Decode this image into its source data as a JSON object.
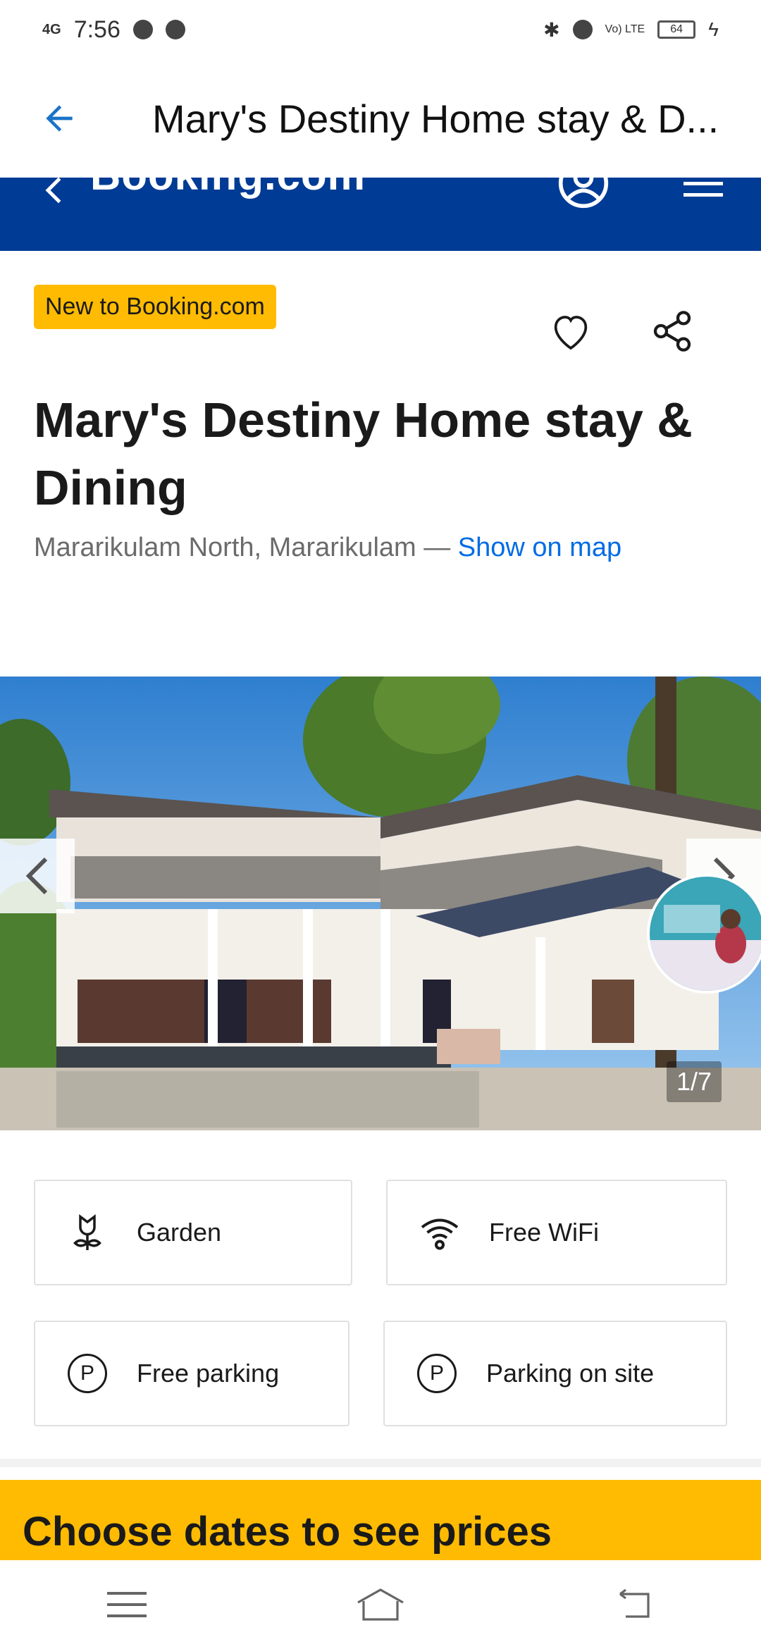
{
  "status_bar": {
    "network": "4G",
    "time": "7:56",
    "volte": "Vo) LTE",
    "battery": "64"
  },
  "app_bar": {
    "title": "Mary's Destiny Home stay & D..."
  },
  "booking_header": {
    "logo": "Booking.com"
  },
  "property": {
    "badge": "New to Booking.com",
    "title": "Mary's Destiny Home stay & Dining",
    "location": "Mararikulam North, Mararikulam",
    "separator": " — ",
    "map_link": "Show on map"
  },
  "gallery": {
    "counter": "1/7"
  },
  "facilities": [
    {
      "label": "Garden",
      "icon": "garden-icon"
    },
    {
      "label": "Free WiFi",
      "icon": "wifi-icon"
    },
    {
      "label": "Free parking",
      "icon": "parking-icon"
    },
    {
      "label": "Parking on site",
      "icon": "parking-icon"
    }
  ],
  "cta": {
    "dates_text": "Choose dates to see prices"
  },
  "colors": {
    "booking_blue": "#003b95",
    "badge_yellow": "#febb02",
    "link_blue": "#006ce4"
  }
}
